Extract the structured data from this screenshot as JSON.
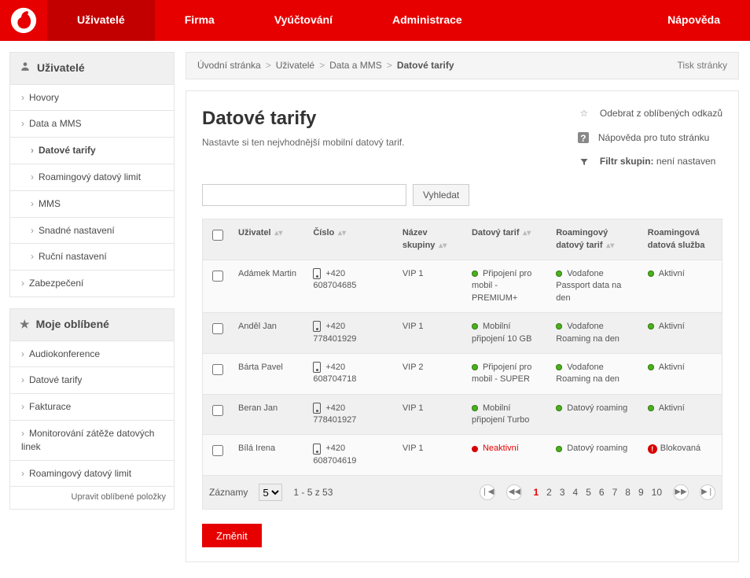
{
  "nav": {
    "items": [
      "Uživatelé",
      "Firma",
      "Vyúčtování",
      "Administrace"
    ],
    "help": "Nápověda",
    "activeIndex": 0
  },
  "sidebar": {
    "title": "Uživatelé",
    "items": [
      {
        "label": "Hovory"
      },
      {
        "label": "Data a MMS"
      },
      {
        "label": "Datové tarify",
        "sub": true,
        "active": true
      },
      {
        "label": "Roamingový datový limit",
        "sub": true
      },
      {
        "label": "MMS",
        "sub": true
      },
      {
        "label": "Snadné nastavení",
        "sub": true
      },
      {
        "label": "Ruční nastavení",
        "sub": true
      },
      {
        "label": "Zabezpečení"
      }
    ],
    "fav_title": "Moje oblíbené",
    "fav_items": [
      {
        "label": "Audiokonference"
      },
      {
        "label": "Datové tarify"
      },
      {
        "label": "Fakturace"
      },
      {
        "label": "Monitorování zátěže datových linek"
      },
      {
        "label": "Roamingový datový limit"
      }
    ],
    "fav_edit": "Upravit oblíbené položky"
  },
  "breadcrumb": {
    "items": [
      "Úvodní stránka",
      "Uživatelé",
      "Data a MMS",
      "Datové tarify"
    ],
    "print": "Tisk stránky"
  },
  "header": {
    "title": "Datové tarify",
    "subtitle": "Nastavte si ten nejvhodnější mobilní datový tarif."
  },
  "tools": {
    "fav_remove": "Odebrat z oblíbených odkazů",
    "help": "Nápověda pro tuto stránku",
    "filter_label": "Filtr skupin:",
    "filter_value": "není nastaven"
  },
  "search": {
    "button": "Vyhledat",
    "value": ""
  },
  "table": {
    "cols": [
      "",
      "Uživatel",
      "Číslo",
      "Název skupiny",
      "Datový tarif",
      "Roamingový datový tarif",
      "Roamingová datová služba"
    ],
    "rows": [
      {
        "user": "Adámek Martin",
        "num": "+420 608704685",
        "grp": "VIP 1",
        "d_tarif": "Připojení pro mobil - PREMIUM+",
        "d_state": "g",
        "r_tarif": "Vodafone Passport data na den",
        "r_state": "g",
        "svc": "Aktivní",
        "svc_state": "g"
      },
      {
        "user": "Anděl Jan",
        "num": "+420 778401929",
        "grp": "VIP 1",
        "d_tarif": "Mobilní připojení 10 GB",
        "d_state": "g",
        "r_tarif": "Vodafone Roaming na den",
        "r_state": "g",
        "svc": "Aktivní",
        "svc_state": "g"
      },
      {
        "user": "Bárta Pavel",
        "num": "+420 608704718",
        "grp": "VIP 2",
        "d_tarif": "Připojení pro mobil - SUPER",
        "d_state": "g",
        "r_tarif": "Vodafone Roaming na den",
        "r_state": "g",
        "svc": "Aktivní",
        "svc_state": "g"
      },
      {
        "user": "Beran Jan",
        "num": "+420 778401927",
        "grp": "VIP 1",
        "d_tarif": "Mobilní připojení Turbo",
        "d_state": "g",
        "r_tarif": "Datový roaming",
        "r_state": "g",
        "svc": "Aktivní",
        "svc_state": "g"
      },
      {
        "user": "Bílá Irena",
        "num": "+420 608704619",
        "grp": "VIP 1",
        "d_tarif": "Neaktivní",
        "d_state": "r",
        "r_tarif": "Datový roaming",
        "r_state": "g",
        "svc": "Blokovaná",
        "svc_state": "bang"
      }
    ]
  },
  "pager": {
    "records_label": "Záznamy",
    "per_page": "5",
    "range": "1 - 5 z 53",
    "pages": [
      "1",
      "2",
      "3",
      "4",
      "5",
      "6",
      "7",
      "8",
      "9",
      "10"
    ],
    "current": "1"
  },
  "actions": {
    "submit": "Změnit"
  }
}
